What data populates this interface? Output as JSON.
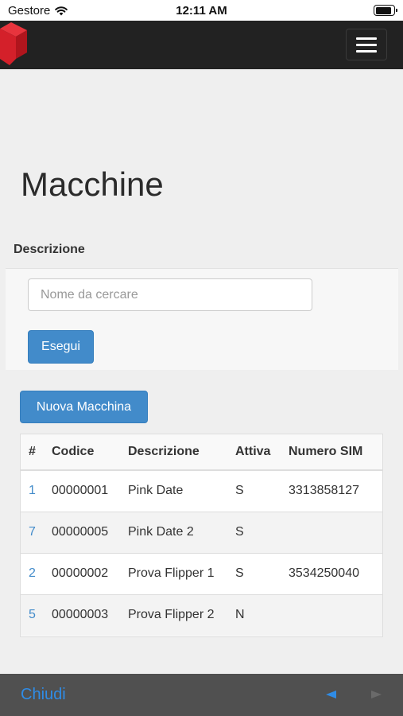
{
  "status_bar": {
    "carrier": "Gestore",
    "time": "12:11 AM",
    "battery_level": 0.9,
    "wifi_icon": "wifi-icon"
  },
  "navbar": {
    "logo_icon": "red-cube-logo",
    "menu_icon": "hamburger-menu-icon",
    "background": "#222222"
  },
  "page": {
    "title": "Macchine"
  },
  "filter": {
    "label": "Descrizione",
    "search_placeholder": "Nome da cercare",
    "search_value": "",
    "submit_label": "Esegui"
  },
  "actions": {
    "new_label": "Nuova Macchina"
  },
  "table": {
    "headers": [
      "#",
      "Codice",
      "Descrizione",
      "Attiva",
      "Numero SIM"
    ],
    "rows": [
      {
        "id": "1",
        "codice": "00000001",
        "descrizione": "Pink Date",
        "attiva": "S",
        "sim": "3313858127"
      },
      {
        "id": "7",
        "codice": "00000005",
        "descrizione": "Pink Date 2",
        "attiva": "S",
        "sim": ""
      },
      {
        "id": "2",
        "codice": "00000002",
        "descrizione": "Prova Flipper 1",
        "attiva": "S",
        "sim": "3534250040"
      },
      {
        "id": "5",
        "codice": "00000003",
        "descrizione": "Prova Flipper 2",
        "attiva": "N",
        "sim": ""
      }
    ]
  },
  "bottom_bar": {
    "close_label": "Chiudi",
    "back_icon": "back-arrow-icon",
    "forward_icon": "forward-arrow-icon"
  },
  "colors": {
    "accent": "#428bca",
    "link": "#2f8ce6",
    "navbar": "#222222",
    "logo_red": "#d4202a"
  }
}
